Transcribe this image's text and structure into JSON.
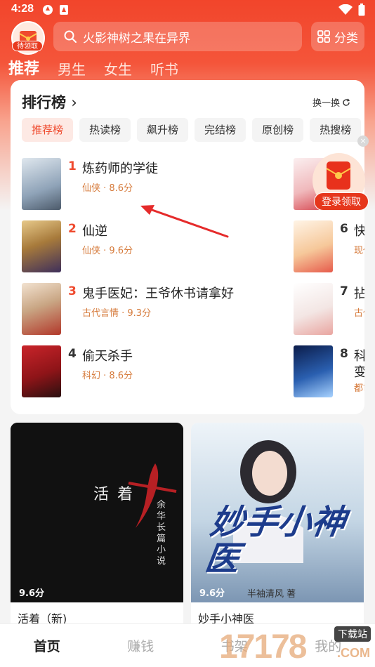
{
  "status": {
    "time": "4:28"
  },
  "header": {
    "gift_label": "待领取",
    "search_placeholder": "火影神树之果在异界",
    "category_label": "分类"
  },
  "tabs": [
    {
      "label": "推荐",
      "active": true
    },
    {
      "label": "男生",
      "active": false
    },
    {
      "label": "女生",
      "active": false
    },
    {
      "label": "听书",
      "active": false
    }
  ],
  "ranking": {
    "title": "排行榜",
    "refresh_label": "换一换",
    "chips": [
      "推荐榜",
      "热读榜",
      "飙升榜",
      "完结榜",
      "原创榜",
      "热搜榜"
    ],
    "left_books": [
      {
        "rank": "1",
        "title": "炼药师的学徒",
        "meta": "仙侠 · 8.6分"
      },
      {
        "rank": "2",
        "title": "仙逆",
        "meta": "仙侠 · 9.6分"
      },
      {
        "rank": "3",
        "title": "鬼手医妃：王爷休书请拿好",
        "meta": "古代言情 · 9.3分"
      },
      {
        "rank": "4",
        "title": "偷天杀手",
        "meta": "科幻 · 8.6分"
      }
    ],
    "right_books": [
      {
        "rank": "",
        "title": "",
        "meta": ""
      },
      {
        "rank": "6",
        "title": "快",
        "meta": "现代"
      },
      {
        "rank": "7",
        "title": "拈",
        "meta": "古代"
      },
      {
        "rank": "8",
        "title": "科",
        "title2": "变",
        "meta": "都市"
      }
    ]
  },
  "float_gift": {
    "label": "登录领取"
  },
  "cards": [
    {
      "title": "活着（新)",
      "score": "9.6分",
      "cover_title": "活着",
      "cover_subtitle": "余华长篇小说"
    },
    {
      "title": "妙手小神医",
      "score": "9.6分",
      "cover_title": "妙手小神医",
      "cover_author": "半袖清风 著"
    }
  ],
  "bottom_nav": [
    {
      "label": "首页",
      "active": true
    },
    {
      "label": "赚钱",
      "active": false
    },
    {
      "label": "书架",
      "active": false
    },
    {
      "label": "我的",
      "active": false
    }
  ],
  "watermark": {
    "label": "17178",
    "sub": "下载站",
    "domain": ".COM"
  },
  "colors": {
    "accent": "#ef4a2e",
    "meta": "#d67b3c"
  }
}
